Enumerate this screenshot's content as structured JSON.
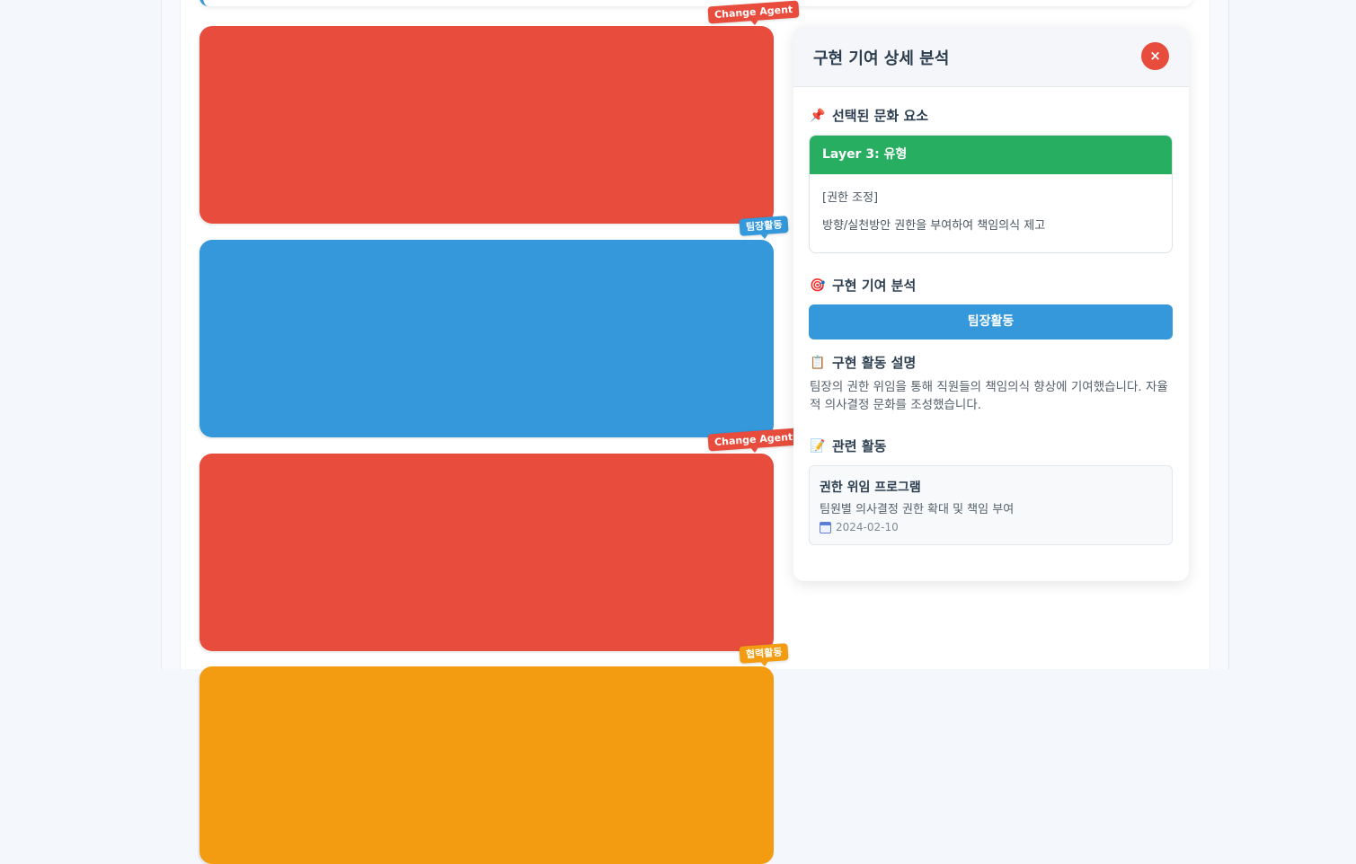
{
  "colors": {
    "red": "#e74c3c",
    "blue": "#3498db",
    "orange": "#f39c12",
    "green": "#27ae60",
    "text": "#2c3e50"
  },
  "cards": [
    {
      "color": "red",
      "tag": "Change Agent"
    },
    {
      "color": "blue",
      "tag": "팀장활동"
    },
    {
      "color": "red",
      "tag": "Change Agent"
    },
    {
      "color": "orange",
      "tag": "협력활동"
    }
  ],
  "detail": {
    "title": "구현 기여 상세 분석",
    "close_label": "×",
    "selected_section": {
      "icon": "📌",
      "title": "선택된 문화 요소"
    },
    "layer": {
      "header": "Layer 3: 유형",
      "category": "[권한 조정]",
      "text": "방향/실천방안 권한을 부여하여 책임의식 제고"
    },
    "analysis_section": {
      "icon": "🎯",
      "title": "구현 기여 분석"
    },
    "activity_label": "팀장활동",
    "desc_section": {
      "icon": "📋",
      "title": "구현 활동 설명"
    },
    "description": "팀장의 권한 위임을 통해 직원들의 책임의식 향상에 기여했습니다. 자율적 의사결정 문화를 조성했습니다.",
    "related_section": {
      "icon": "📝",
      "title": "관련 활동"
    },
    "related": {
      "title": "권한 위임 프로그램",
      "subtitle": "팀원별 의사결정 권한 확대 및 책임 부여",
      "date": "2024-02-10"
    }
  }
}
